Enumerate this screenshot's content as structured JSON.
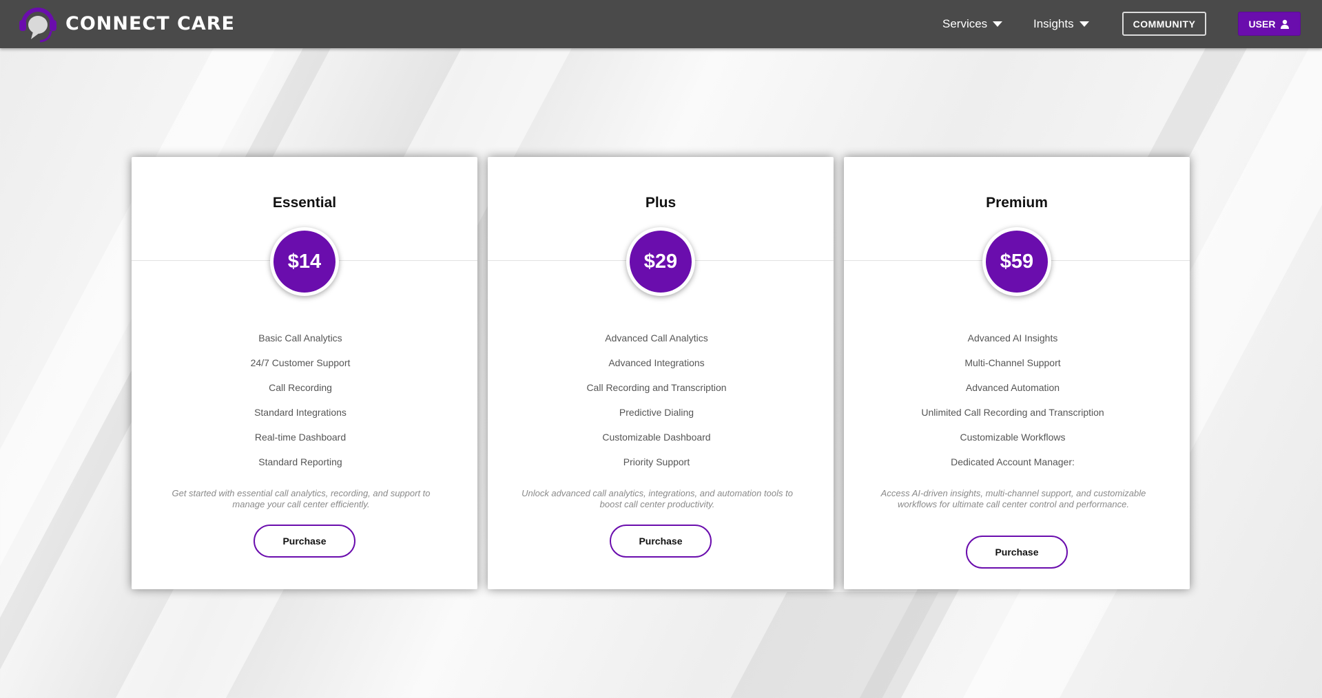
{
  "header": {
    "brand": "CONNECT CARE",
    "nav": {
      "services": "Services",
      "insights": "Insights",
      "community": "COMMUNITY",
      "user": "USER"
    }
  },
  "colors": {
    "accent": "#6a0dad",
    "navbar": "#4a4a4a"
  },
  "plans": [
    {
      "name": "Essential",
      "price": "$14",
      "features": [
        "Basic Call Analytics",
        "24/7 Customer Support",
        "Call Recording",
        "Standard Integrations",
        "Real-time Dashboard",
        "Standard Reporting"
      ],
      "description": "Get started with essential call analytics, recording, and support to manage your call center efficiently.",
      "button": "Purchase"
    },
    {
      "name": "Plus",
      "price": "$29",
      "features": [
        "Advanced Call Analytics",
        "Advanced Integrations",
        "Call Recording and Transcription",
        "Predictive Dialing",
        "Customizable Dashboard",
        "Priority Support"
      ],
      "description": "Unlock advanced call analytics, integrations, and automation tools to boost call center productivity.",
      "button": "Purchase"
    },
    {
      "name": "Premium",
      "price": "$59",
      "features": [
        "Advanced AI Insights",
        "Multi-Channel Support",
        "Advanced Automation",
        "Unlimited Call Recording and Transcription",
        "Customizable Workflows",
        "Dedicated Account Manager:"
      ],
      "description": "Access AI-driven insights, multi-channel support, and customizable workflows for ultimate call center control and performance.",
      "button": "Purchase"
    }
  ]
}
